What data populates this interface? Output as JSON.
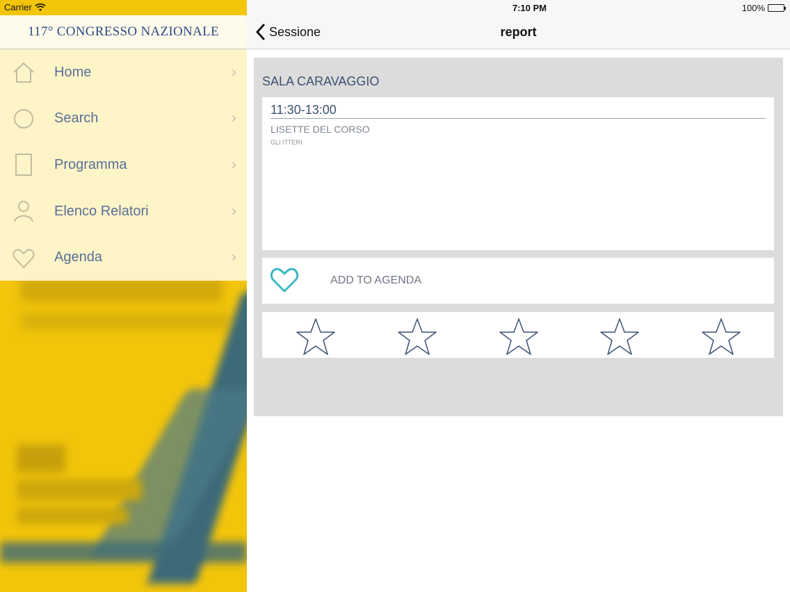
{
  "status": {
    "carrier": "Carrier",
    "time": "7:10 PM",
    "battery": "100%"
  },
  "sidebar": {
    "title": "117° CONGRESSO NAZIONALE",
    "items": [
      {
        "label": "Home",
        "icon": "home-icon"
      },
      {
        "label": "Search",
        "icon": "search-icon"
      },
      {
        "label": "Programma",
        "icon": "document-icon"
      },
      {
        "label": "Elenco Relatori",
        "icon": "person-icon"
      },
      {
        "label": "Agenda",
        "icon": "agenda-icon"
      }
    ]
  },
  "navbar": {
    "back_label": "Sessione",
    "title": "report"
  },
  "session": {
    "room": "SALA CARAVAGGIO",
    "time": "11:30-13:00",
    "speaker": "LISETTE DEL CORSO",
    "subtitle": "GLI ITTERI"
  },
  "agenda": {
    "label": "ADD TO AGENDA",
    "icon": "heart-icon",
    "color": "#3ab7c4"
  },
  "rating": {
    "stars": 5,
    "filled": 0,
    "star_color": "#3c5173"
  }
}
